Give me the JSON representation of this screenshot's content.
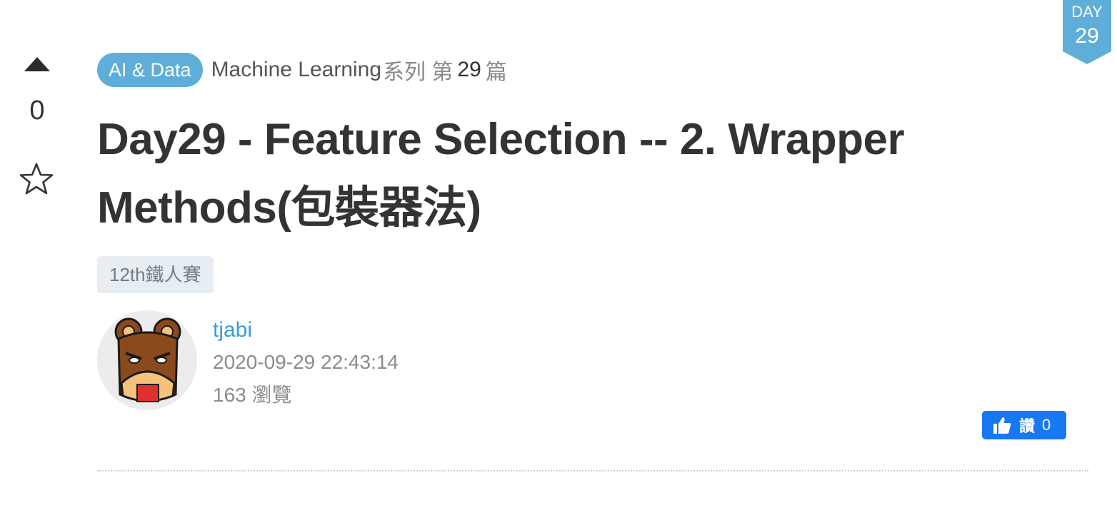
{
  "vote": {
    "count": "0",
    "up_icon": "triangle-up-icon",
    "bookmark_icon": "star-icon"
  },
  "ribbon": {
    "label": "DAY",
    "number": "29",
    "color": "#5eaed9"
  },
  "series": {
    "category": "AI & Data",
    "name": "Machine Learning",
    "suffix": "系列 第",
    "number": "29",
    "end": "篇"
  },
  "title": "Day29 - Feature Selection -- 2. Wrapper Methods(包裝器法)",
  "tag": "12th鐵人賽",
  "author": {
    "name": "tjabi",
    "posted_at": "2020-09-29 22:43:14",
    "views": "163 瀏覽"
  },
  "like": {
    "label": "讚",
    "count": "0",
    "icon": "thumbs-up-icon",
    "color": "#1877f2"
  },
  "colors": {
    "accent": "#5eaed9",
    "link": "#3b9bdb",
    "text": "#333333"
  }
}
